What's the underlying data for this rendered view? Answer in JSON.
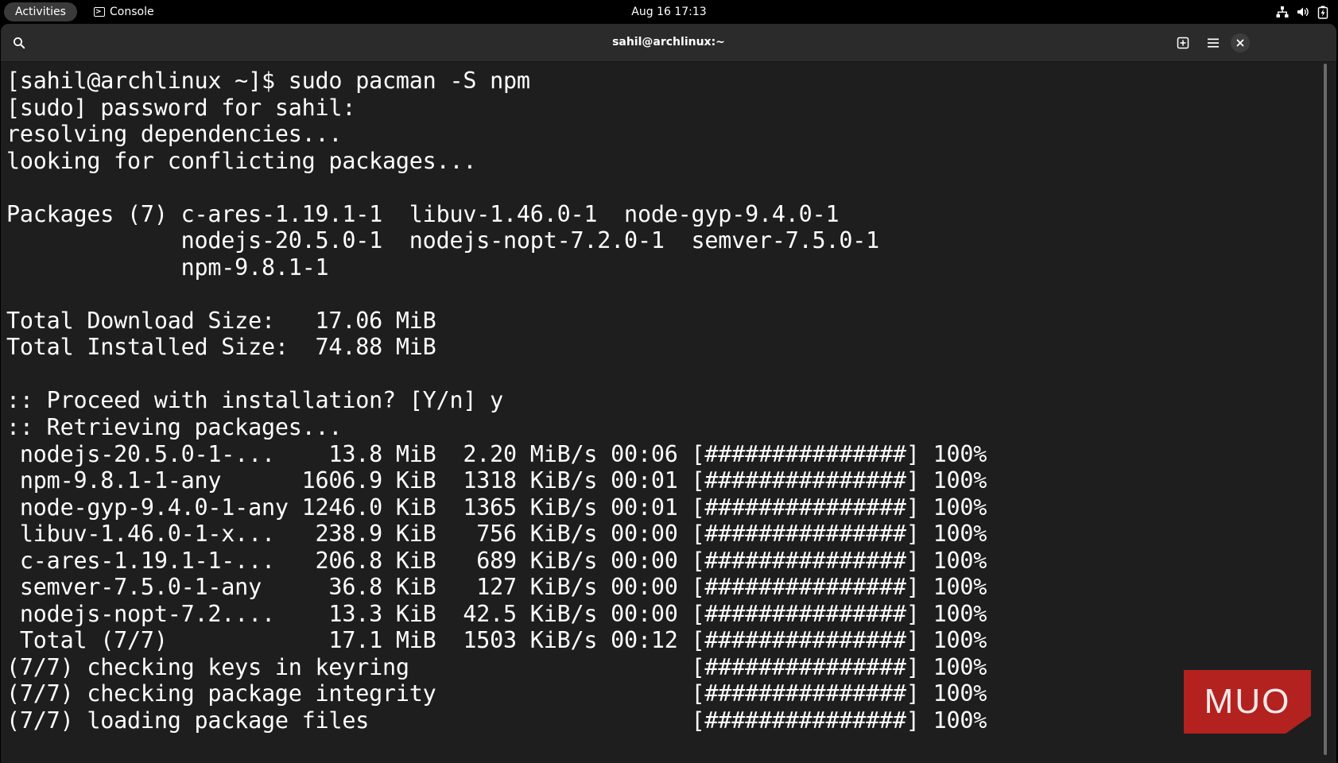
{
  "topbar": {
    "activities_label": "Activities",
    "app_name": "Console",
    "clock": "Aug 16  17:13",
    "tray_icons": [
      "network-icon",
      "volume-icon",
      "battery-icon"
    ]
  },
  "window": {
    "title": "sahil@archlinux:~",
    "buttons": [
      "search-icon",
      "new-tab-icon",
      "menu-icon",
      "close-icon"
    ]
  },
  "terminal": {
    "lines": [
      "[sahil@archlinux ~]$ sudo pacman -S npm",
      "[sudo] password for sahil:",
      "resolving dependencies...",
      "looking for conflicting packages...",
      "",
      "Packages (7) c-ares-1.19.1-1  libuv-1.46.0-1  node-gyp-9.4.0-1",
      "             nodejs-20.5.0-1  nodejs-nopt-7.2.0-1  semver-7.5.0-1",
      "             npm-9.8.1-1",
      "",
      "Total Download Size:   17.06 MiB",
      "Total Installed Size:  74.88 MiB",
      "",
      ":: Proceed with installation? [Y/n] y",
      ":: Retrieving packages...",
      " nodejs-20.5.0-1-...    13.8 MiB  2.20 MiB/s 00:06 [###############] 100%",
      " npm-9.8.1-1-any      1606.9 KiB  1318 KiB/s 00:01 [###############] 100%",
      " node-gyp-9.4.0-1-any 1246.0 KiB  1365 KiB/s 00:01 [###############] 100%",
      " libuv-1.46.0-1-x...   238.9 KiB   756 KiB/s 00:00 [###############] 100%",
      " c-ares-1.19.1-1-...   206.8 KiB   689 KiB/s 00:00 [###############] 100%",
      " semver-7.5.0-1-any     36.8 KiB   127 KiB/s 00:00 [###############] 100%",
      " nodejs-nopt-7.2....    13.3 KiB  42.5 KiB/s 00:00 [###############] 100%",
      " Total (7/7)            17.1 MiB  1503 KiB/s 00:12 [###############] 100%",
      "(7/7) checking keys in keyring                     [###############] 100%",
      "(7/7) checking package integrity                   [###############] 100%",
      "(7/7) loading package files                        [###############] 100%"
    ]
  },
  "watermark": {
    "text": "MUO",
    "color": "#b3221f"
  }
}
